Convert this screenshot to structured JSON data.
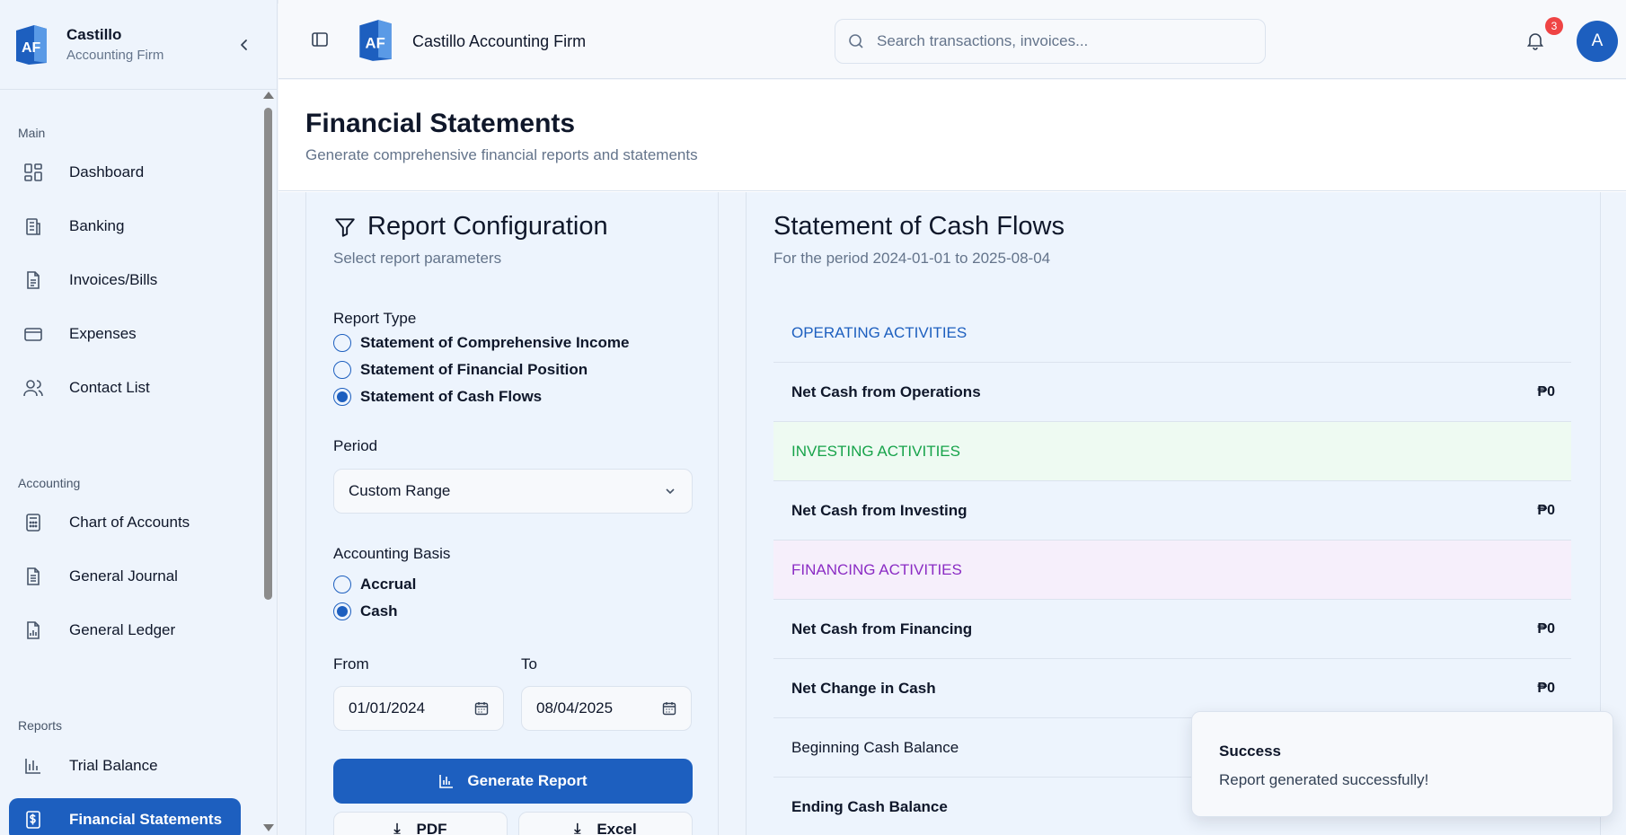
{
  "brand": {
    "name": "Castillo",
    "subtitle": "Accounting Firm"
  },
  "sidebar": {
    "sections": [
      {
        "label": "Main",
        "items": [
          {
            "label": "Dashboard",
            "icon": "dashboard-icon"
          },
          {
            "label": "Banking",
            "icon": "bank-icon"
          },
          {
            "label": "Invoices/Bills",
            "icon": "document-icon"
          },
          {
            "label": "Expenses",
            "icon": "credit-card-icon"
          },
          {
            "label": "Contact List",
            "icon": "users-icon"
          }
        ]
      },
      {
        "label": "Accounting",
        "items": [
          {
            "label": "Chart of Accounts",
            "icon": "calculator-icon"
          },
          {
            "label": "General Journal",
            "icon": "journal-icon"
          },
          {
            "label": "General Ledger",
            "icon": "ledger-icon"
          }
        ]
      },
      {
        "label": "Reports",
        "items": [
          {
            "label": "Trial Balance",
            "icon": "bar-chart-icon"
          },
          {
            "label": "Financial Statements",
            "icon": "dollar-document-icon",
            "active": true
          }
        ]
      }
    ]
  },
  "topbar": {
    "title": "Castillo Accounting Firm",
    "search_placeholder": "Search transactions, invoices...",
    "notification_count": "3",
    "avatar_initial": "A"
  },
  "page": {
    "title": "Financial Statements",
    "subtitle": "Generate comprehensive financial reports and statements"
  },
  "config": {
    "title": "Report Configuration",
    "subtitle": "Select report parameters",
    "report_type_label": "Report Type",
    "report_types": [
      {
        "label": "Statement of Comprehensive Income",
        "selected": false
      },
      {
        "label": "Statement of Financial Position",
        "selected": false
      },
      {
        "label": "Statement of Cash Flows",
        "selected": true
      }
    ],
    "period_label": "Period",
    "period_value": "Custom Range",
    "basis_label": "Accounting Basis",
    "basis_options": [
      {
        "label": "Accrual",
        "selected": false
      },
      {
        "label": "Cash",
        "selected": true
      }
    ],
    "from_label": "From",
    "from_value": "01/01/2024",
    "to_label": "To",
    "to_value": "08/04/2025",
    "generate_label": "Generate Report",
    "pdf_label": "PDF",
    "excel_label": "Excel"
  },
  "statement": {
    "title": "Statement of Cash Flows",
    "subtitle": "For the period 2024-01-01 to 2025-08-04",
    "rows": [
      {
        "label": "OPERATING ACTIVITIES",
        "amount": ""
      },
      {
        "label": "Net Cash from Operations",
        "amount": "₱0"
      },
      {
        "label": "INVESTING ACTIVITIES",
        "amount": ""
      },
      {
        "label": "Net Cash from Investing",
        "amount": "₱0"
      },
      {
        "label": "FINANCING ACTIVITIES",
        "amount": ""
      },
      {
        "label": "Net Cash from Financing",
        "amount": "₱0"
      },
      {
        "label": "Net Change in Cash",
        "amount": "₱0"
      },
      {
        "label": "Beginning Cash Balance",
        "amount": ""
      },
      {
        "label": "Ending Cash Balance",
        "amount": ""
      }
    ]
  },
  "toast": {
    "title": "Success",
    "message": "Report generated successfully!"
  },
  "colors": {
    "primary": "#1d5fbf",
    "operating": "#1d5fbf",
    "investing": "#16a34a",
    "financing": "#8b2cc4",
    "badge": "#ef4444"
  }
}
